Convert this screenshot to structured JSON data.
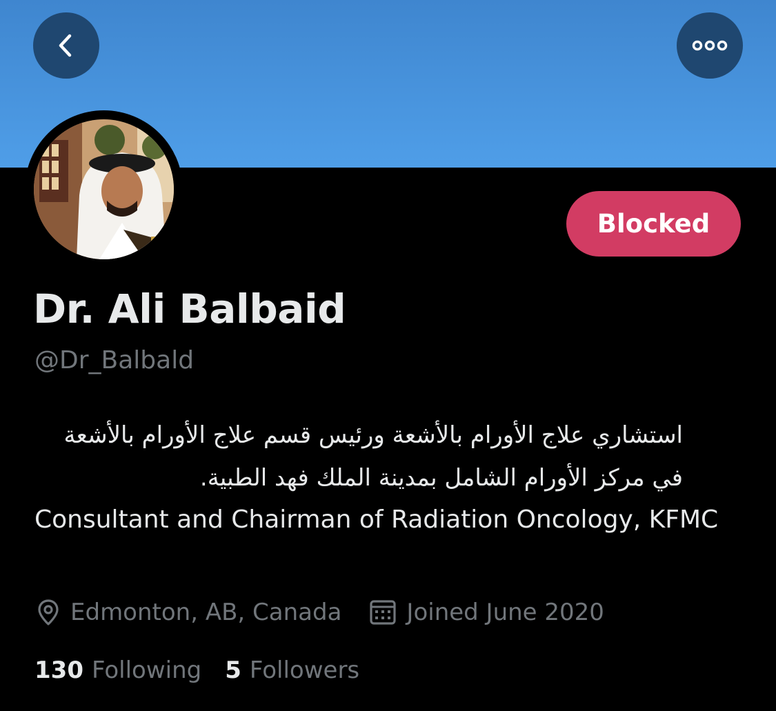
{
  "header": {
    "back_icon": "chevron-left-icon",
    "more_icon": "more-horizontal-icon"
  },
  "profile": {
    "display_name": "Dr. Ali Balbaid",
    "handle": "@Dr_Balbald",
    "blocked_label": "Blocked",
    "bio_arabic": "استشاري علاج الأورام بالأشعة ورئيس قسم علاج الأورام بالأشعة في مركز الأورام الشامل بمدينة الملك فهد الطبية.",
    "bio_english": "Consultant and Chairman of Radiation Oncology, KFMC",
    "location": "Edmonton, AB, Canada",
    "joined": "Joined June 2020",
    "following_count": "130",
    "following_label": "Following",
    "followers_count": "5",
    "followers_label": "Followers"
  },
  "colors": {
    "banner": "#4a95df",
    "background": "#000000",
    "blocked_button": "#d23c63",
    "primary_text": "#e7e9ea",
    "secondary_text": "#71767b",
    "nav_button": "#1f4770"
  }
}
